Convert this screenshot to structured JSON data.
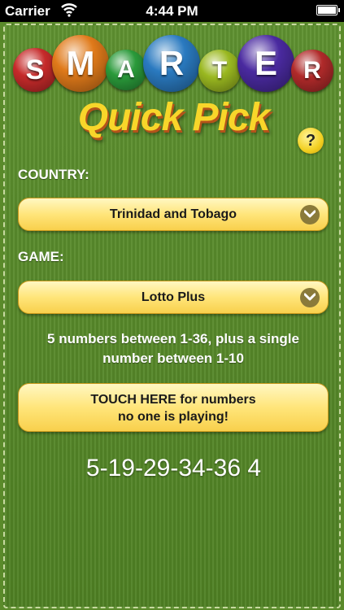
{
  "status_bar": {
    "carrier": "Carrier",
    "time": "4:44 PM"
  },
  "logo": {
    "letters": [
      {
        "char": "S",
        "color": "#c62a2a"
      },
      {
        "char": "M",
        "color": "#e07a1a"
      },
      {
        "char": "A",
        "color": "#2a9a3a"
      },
      {
        "char": "R",
        "color": "#2a7ac0"
      },
      {
        "char": "T",
        "color": "#9ab820"
      },
      {
        "char": "E",
        "color": "#4a2aa0"
      },
      {
        "char": "R",
        "color": "#b02a2a"
      }
    ],
    "subtitle": "Quick Pick"
  },
  "help_button": "?",
  "country": {
    "label": "COUNTRY:",
    "selected": "Trinidad and Tobago"
  },
  "game": {
    "label": "GAME:",
    "selected": "Lotto Plus"
  },
  "description": {
    "line1": "5 numbers between 1-36, plus a single",
    "line2": "number between 1-10"
  },
  "touch_button": {
    "line1": "TOUCH HERE for numbers",
    "line2": "no one is playing!"
  },
  "result": "5-19-29-34-36 4",
  "colors": {
    "background": "#5a8a2a",
    "button": "#ffe57a",
    "subtitle": "#f8d62a"
  }
}
